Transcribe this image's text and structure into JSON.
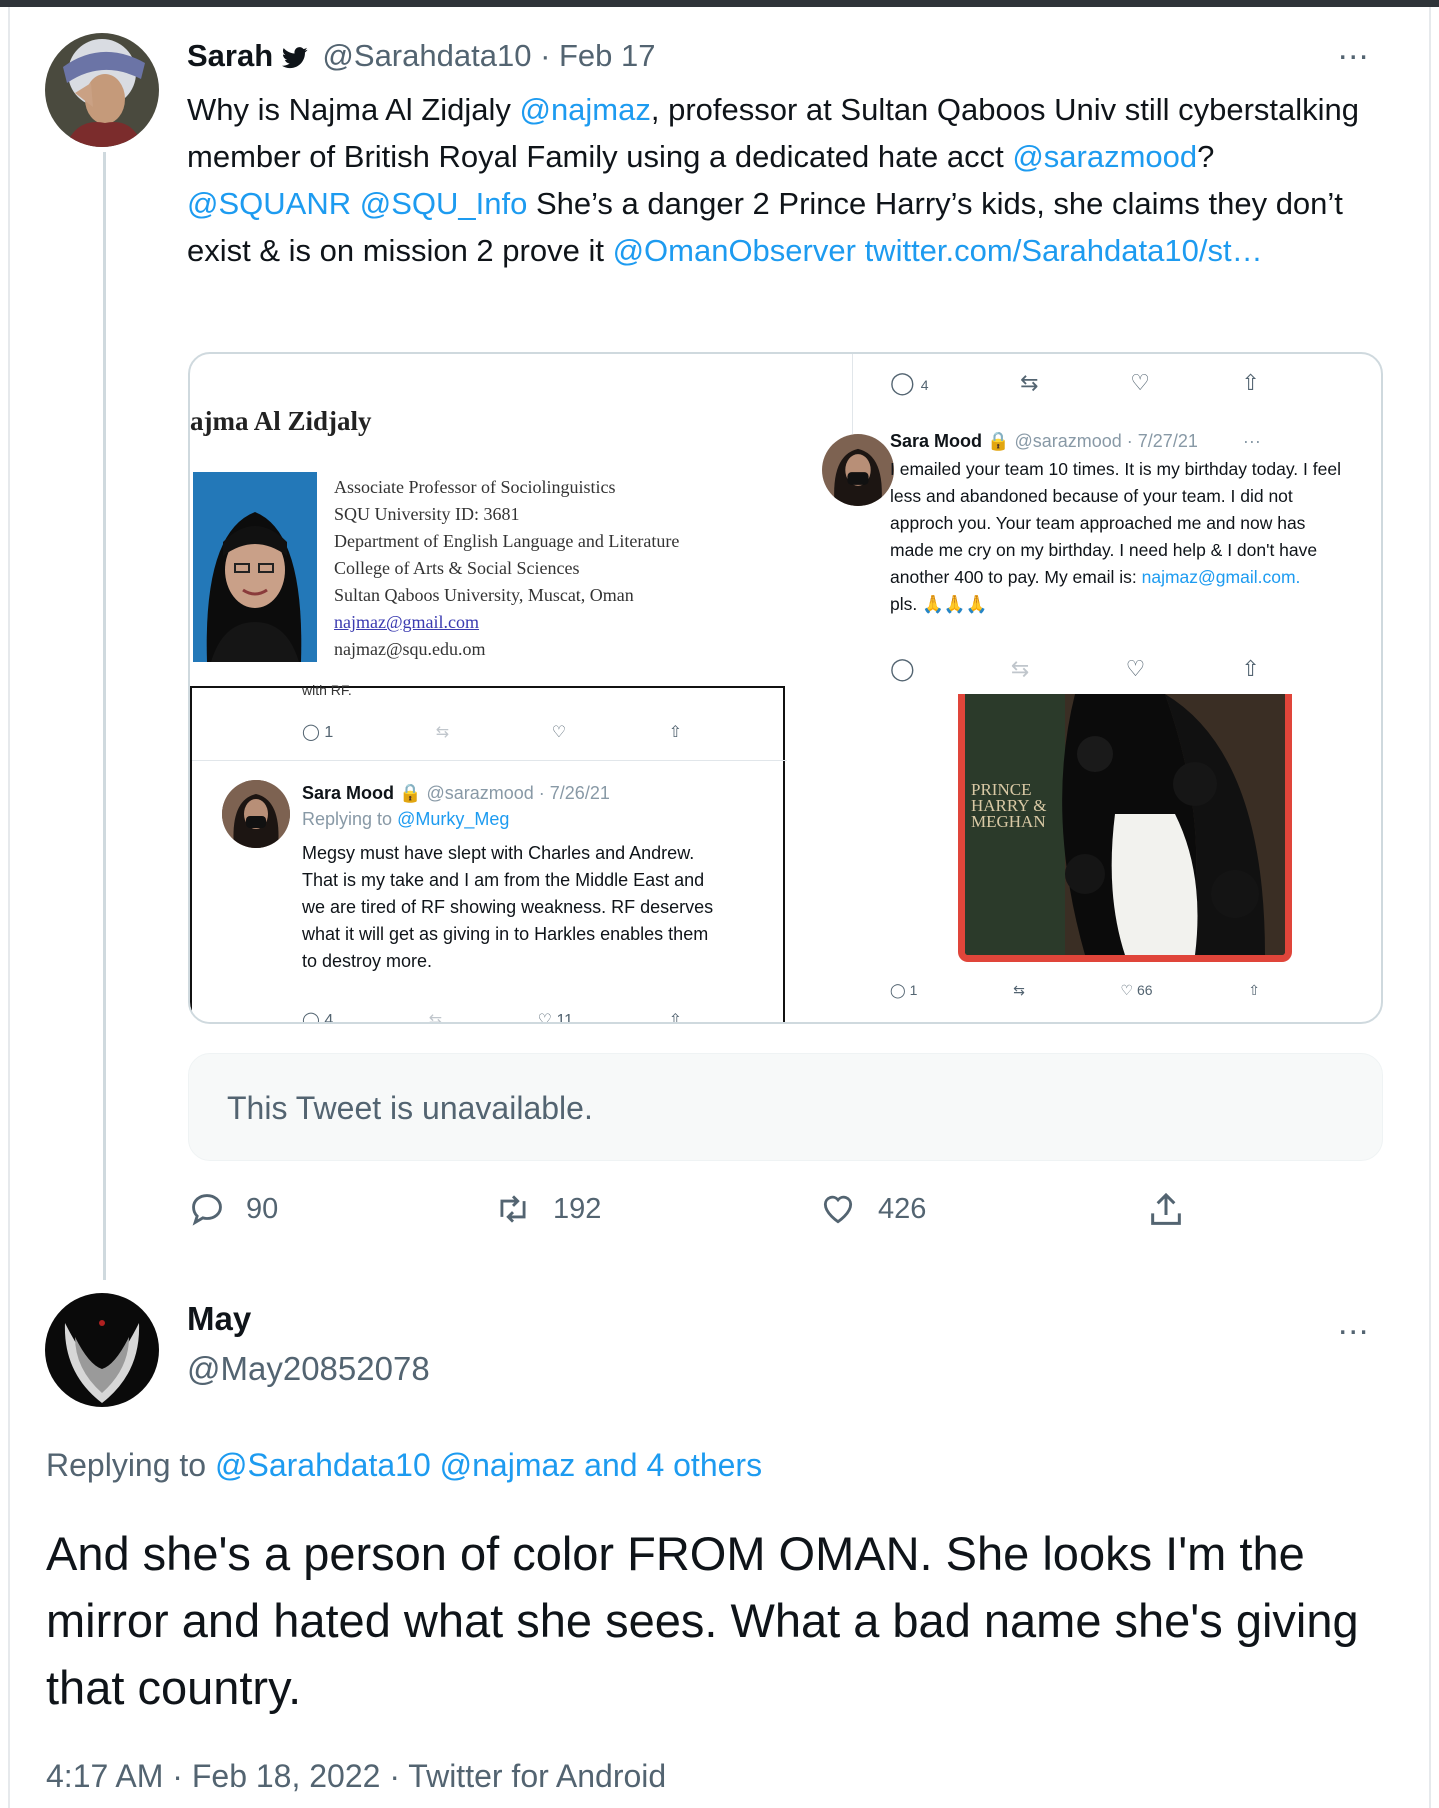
{
  "colors": {
    "link": "#1d9bf0",
    "muted": "#536471",
    "text": "#0f1419",
    "divider": "#cfd9de"
  },
  "tweet1": {
    "name": "Sarah",
    "badge_icon": "twitter-bird-icon",
    "handle": "@Sarahdata10",
    "date": "Feb 17",
    "more": "...",
    "body_parts": [
      {
        "t": "Why is Najma Al Zidjaly ",
        "link": false
      },
      {
        "t": "@najmaz",
        "link": true
      },
      {
        "t": ", professor at Sultan Qaboos Univ still cyberstalking member of British Royal Family using a dedicated hate acct ",
        "link": false
      },
      {
        "t": "@sarazmood",
        "link": true
      },
      {
        "t": "? ",
        "link": false
      },
      {
        "t": "@SQUANR",
        "link": true
      },
      {
        "t": " ",
        "link": false
      },
      {
        "t": "@SQU_Info",
        "link": true
      },
      {
        "t": " She’s a danger 2 Prince Harry’s kids, she claims they don’t exist & is on mission 2 prove it ",
        "link": false
      },
      {
        "t": "@OmanObserver",
        "link": true
      },
      {
        "t": "  ",
        "link": false
      },
      {
        "t": "twitter.com/Sarahdata10/st…",
        "link": true
      }
    ],
    "media": {
      "profile_name": "ajma Al Zidjaly",
      "profile_lines": [
        "Associate Professor of Sociolinguistics",
        "SQU University ID: 3681",
        "Department of English Language and Literature",
        "College of Arts & Social Sciences",
        "Sultan Qaboos University, Muscat, Oman"
      ],
      "profile_email_link": "najmaz@gmail.com",
      "profile_email2": "najmaz@squ.edu.om",
      "cut_text": "with RF.",
      "left_counts": {
        "reply": "1"
      },
      "left_tweet": {
        "name": "Sara Mood",
        "handle_date": "@sarazmood · 7/26/21",
        "replying_prefix": "Replying to ",
        "replying_handle": "@Murky_Meg",
        "text": "Megsy must have slept with Charles and Andrew. That is my take and I am from the Middle East and we are tired of RF showing weakness. RF deserves what it will get as giving in to Harkles enables them to destroy more.",
        "bottom_counts": {
          "reply": "4",
          "like": "11"
        }
      },
      "right_top_counts": {
        "reply": "4"
      },
      "right_tweet": {
        "name": "Sara Mood",
        "handle_date": "@sarazmood · 7/27/21",
        "more": "···",
        "text": "I emailed your team 10 times. It is my birthday today. I feel less and abandoned because of your team. I did not approch you. Your team approached me and now has made me cry on my birthday. I need help & I don't have another 400 to pay. My email is: ",
        "email": "najmaz@gmail.com.",
        "end": "pls. 🙏🙏🙏"
      },
      "book_title_lines": [
        "PRINCE",
        "HARRY &",
        "MEGHAN"
      ],
      "right_bottom_counts": {
        "reply": "1",
        "like": "66"
      }
    },
    "unavailable": "This Tweet is unavailable.",
    "counts": {
      "replies": "90",
      "retweets": "192",
      "likes": "426"
    }
  },
  "tweet2": {
    "name": "May",
    "handle": "@May20852078",
    "more": "...",
    "replying_prefix": "Replying to ",
    "replying_to": "@Sarahdata10 @najmaz and 4 others",
    "body": "And she's a person of color FROM OMAN. She looks I'm the mirror and hated what she sees. What a bad name she's giving that country.",
    "timestamp": "4:17 AM · Feb 18, 2022 · Twitter for Android"
  }
}
